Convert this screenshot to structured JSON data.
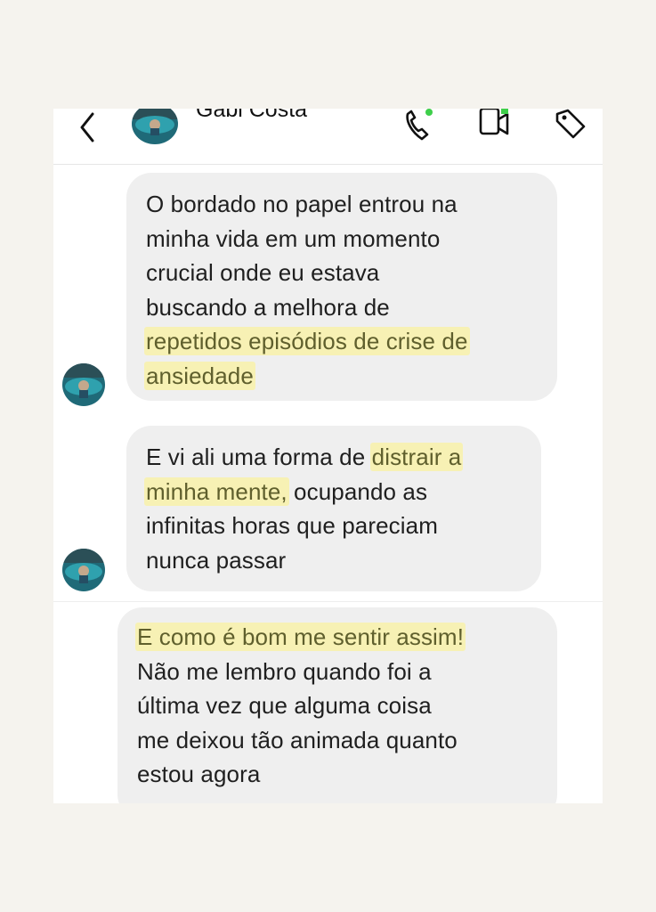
{
  "header": {
    "contact_name": "Gabi Costa",
    "icons": [
      "chevron-left-icon",
      "avatar",
      "phone-icon",
      "video-icon",
      "tag-icon"
    ]
  },
  "messages": [
    {
      "lines": [
        "O bordado no papel entrou na",
        "minha vida em um momento",
        "crucial onde eu estava",
        "buscando a melhora de",
        "repetidos episódios de crise de",
        "ansiedade"
      ],
      "highlighted_lines": [
        4,
        5
      ]
    },
    {
      "lines": [
        "E vi ali uma forma de ",
        "distrair a",
        "minha mente,",
        " ocupando as",
        "infinitas horas que pareciam",
        "nunca passar"
      ]
    },
    {
      "lines": [
        "E como é bom me sentir assim!",
        "Não me lembro quando foi a",
        "última vez que alguma coisa",
        "me deixou tão animada quanto",
        "estou agora"
      ],
      "highlighted_lines": [
        0
      ]
    }
  ],
  "colors": {
    "page_background": "#f5f3ee",
    "bubble": "#efefef",
    "highlight": "#f9f2a0",
    "online_dot": "#3ecf4a"
  }
}
